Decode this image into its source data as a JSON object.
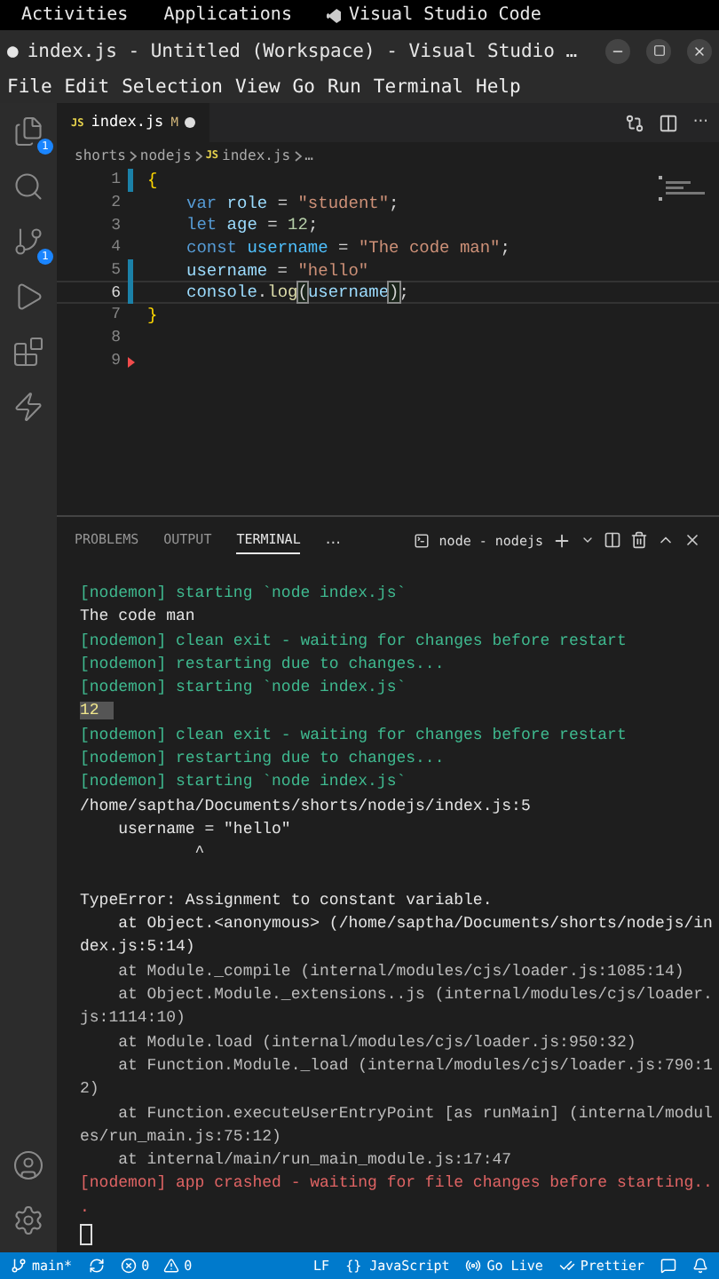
{
  "top_bar": {
    "activities": "Activities",
    "applications": "Applications",
    "app_name": "Visual Studio Code"
  },
  "window": {
    "modified_dot": "●",
    "title": "index.js - Untitled (Workspace) - Visual Studio …"
  },
  "menu": [
    "File",
    "Edit",
    "Selection",
    "View",
    "Go",
    "Run",
    "Terminal",
    "Help"
  ],
  "activity_bar": {
    "items": [
      {
        "kind": "files",
        "badge": "1",
        "selected": false
      },
      {
        "kind": "search",
        "selected": false
      },
      {
        "kind": "source-control",
        "badge": "1",
        "selected": false
      },
      {
        "kind": "run",
        "selected": false
      },
      {
        "kind": "extensions",
        "selected": false
      },
      {
        "kind": "remote",
        "selected": false
      }
    ],
    "bottom": [
      {
        "kind": "account"
      },
      {
        "kind": "settings"
      }
    ]
  },
  "editor_tabs": [
    {
      "icon": "JS",
      "label": "index.js",
      "status": "M",
      "dirty": true,
      "selected": true
    }
  ],
  "editor_actions": {
    "more": "···"
  },
  "breadcrumb": [
    {
      "label": "shorts"
    },
    {
      "label": "nodejs"
    },
    {
      "icon": "JS",
      "label": "index.js"
    },
    {
      "label": "…"
    }
  ],
  "code": [
    {
      "number": "1",
      "indented": false,
      "modified": true,
      "deleted": false,
      "current": false,
      "tokens": [
        {
          "kind": "brace",
          "text": "{"
        }
      ]
    },
    {
      "number": "2",
      "indented": true,
      "modified": false,
      "deleted": false,
      "current": false,
      "tokens": [
        {
          "kind": "keyword",
          "text": "var"
        },
        {
          "kind": "variable",
          "text": " role"
        },
        {
          "kind": "plain",
          "text": " = "
        },
        {
          "kind": "string",
          "text": "\"student\""
        },
        {
          "kind": "plain",
          "text": ";"
        }
      ]
    },
    {
      "number": "3",
      "indented": true,
      "modified": false,
      "deleted": false,
      "current": false,
      "tokens": [
        {
          "kind": "keyword",
          "text": "let"
        },
        {
          "kind": "variable",
          "text": " age"
        },
        {
          "kind": "plain",
          "text": " = "
        },
        {
          "kind": "number",
          "text": "12"
        },
        {
          "kind": "plain",
          "text": ";"
        }
      ]
    },
    {
      "number": "4",
      "indented": true,
      "modified": false,
      "deleted": false,
      "current": false,
      "tokens": [
        {
          "kind": "keyword",
          "text": "const"
        },
        {
          "kind": "constant",
          "text": " username"
        },
        {
          "kind": "plain",
          "text": " = "
        },
        {
          "kind": "string",
          "text": "\"The code man\""
        },
        {
          "kind": "plain",
          "text": ";"
        }
      ]
    },
    {
      "number": "5",
      "indented": true,
      "modified": true,
      "deleted": false,
      "current": false,
      "tokens": [
        {
          "kind": "variable",
          "text": "username"
        },
        {
          "kind": "plain",
          "text": " = "
        },
        {
          "kind": "string",
          "text": "\"hello\""
        }
      ]
    },
    {
      "number": "6",
      "indented": true,
      "modified": true,
      "deleted": false,
      "current": true,
      "tokens": [
        {
          "kind": "variable",
          "text": "console"
        },
        {
          "kind": "plain",
          "text": "."
        },
        {
          "kind": "function",
          "text": "log"
        },
        {
          "kind": "match",
          "text": "("
        },
        {
          "kind": "variable",
          "text": "username"
        },
        {
          "kind": "match",
          "text": ")"
        },
        {
          "kind": "plain",
          "text": ";"
        }
      ]
    },
    {
      "number": "7",
      "indented": false,
      "modified": false,
      "deleted": false,
      "current": false,
      "tokens": [
        {
          "kind": "brace",
          "text": "}"
        }
      ]
    },
    {
      "number": "8",
      "modified": false,
      "deleted": false,
      "current": false
    },
    {
      "number": "9",
      "modified": false,
      "deleted": true,
      "current": false
    }
  ],
  "panel": {
    "tabs": [
      {
        "label": "PROBLEMS",
        "selected": false
      },
      {
        "label": "OUTPUT",
        "selected": false
      },
      {
        "label": "TERMINAL",
        "selected": true
      }
    ],
    "more": "...",
    "terminal_name": "node - nodejs"
  },
  "terminal": [
    {
      "kind": "nodemon",
      "text": "[nodemon] starting `node index.js`"
    },
    {
      "kind": "output",
      "text": "The code man"
    },
    {
      "kind": "nodemon",
      "text": "[nodemon] clean exit - waiting for changes before restart"
    },
    {
      "kind": "nodemon",
      "text": "[nodemon] restarting due to changes..."
    },
    {
      "kind": "nodemon",
      "text": "[nodemon] starting `node index.js`"
    },
    {
      "kind": "highlight",
      "text": "12"
    },
    {
      "kind": "nodemon",
      "text": "[nodemon] clean exit - waiting for changes before restart"
    },
    {
      "kind": "nodemon",
      "text": "[nodemon] restarting due to changes..."
    },
    {
      "kind": "nodemon",
      "text": "[nodemon] starting `node index.js`"
    },
    {
      "kind": "output",
      "text": "/home/saptha/Documents/shorts/nodejs/index.js:5"
    },
    {
      "kind": "output",
      "text": "    username = \"hello\""
    },
    {
      "kind": "output",
      "text": "            ^"
    },
    {
      "kind": "blank"
    },
    {
      "kind": "output",
      "text": "TypeError: Assignment to constant variable."
    },
    {
      "kind": "output",
      "text": "    at Object.<anonymous> (/home/saptha/Documents/shorts/nodejs/in"
    },
    {
      "kind": "output",
      "text": "dex.js:5:14)"
    },
    {
      "kind": "trace",
      "text": "    at Module._compile (internal/modules/cjs/loader.js:1085:14)"
    },
    {
      "kind": "trace",
      "text": "    at Object.Module._extensions..js (internal/modules/cjs/loader."
    },
    {
      "kind": "trace",
      "text": "js:1114:10)"
    },
    {
      "kind": "trace",
      "text": "    at Module.load (internal/modules/cjs/loader.js:950:32)"
    },
    {
      "kind": "trace",
      "text": "    at Function.Module._load (internal/modules/cjs/loader.js:790:1"
    },
    {
      "kind": "trace",
      "text": "2)"
    },
    {
      "kind": "trace",
      "text": "    at Function.executeUserEntryPoint [as runMain] (internal/modul"
    },
    {
      "kind": "trace",
      "text": "es/run_main.js:75:12)"
    },
    {
      "kind": "trace",
      "text": "    at internal/main/run_main_module.js:17:47"
    },
    {
      "kind": "error",
      "text": "[nodemon] app crashed - waiting for file changes before starting.."
    },
    {
      "kind": "error",
      "text": "."
    }
  ],
  "status_bar": {
    "branch": "main*",
    "errors": "0",
    "warnings": "0",
    "eol": "LF",
    "language_icon": "{}",
    "language": "JavaScript",
    "live": "Go Live",
    "formatter": "Prettier"
  }
}
